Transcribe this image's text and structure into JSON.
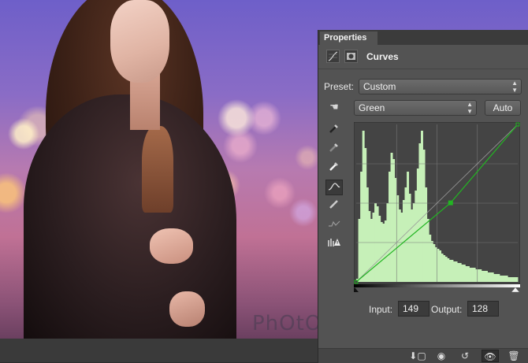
{
  "panel": {
    "tab_label": "Properties",
    "title": "Curves",
    "preset_label": "Preset:",
    "preset_value": "Custom",
    "channel_value": "Green",
    "auto_label": "Auto",
    "input_label": "Input:",
    "input_value": "149",
    "output_label": "Output:",
    "output_value": "128"
  },
  "icons": {
    "header": [
      "curves-adjustment-icon",
      "layer-mask-icon"
    ],
    "tools": [
      "on-image-adjust-icon",
      "set-black-point-eyedropper-icon",
      "set-gray-point-eyedropper-icon",
      "set-white-point-eyedropper-icon",
      "edit-points-curve-icon",
      "draw-pencil-icon",
      "smooth-curve-icon",
      "clipping-warning-icon"
    ],
    "footer": [
      "clip-to-layer-icon",
      "view-previous-state-icon",
      "reset-icon",
      "toggle-visibility-icon",
      "trash-icon"
    ]
  },
  "colors": {
    "curve": "#22b522",
    "histogram": "#c6f0b8",
    "panel_bg": "#535353"
  },
  "watermark": "PhOtOPrO",
  "curve": {
    "points": [
      [
        0,
        0
      ],
      [
        149,
        128
      ],
      [
        255,
        255
      ]
    ]
  },
  "histogram": [
    2,
    40,
    70,
    96,
    85,
    60,
    45,
    40,
    44,
    50,
    48,
    42,
    38,
    37,
    39,
    50,
    70,
    82,
    78,
    66,
    55,
    46,
    44,
    52,
    60,
    70,
    56,
    46,
    50,
    58,
    72,
    88,
    96,
    84,
    60,
    40,
    30,
    26,
    24,
    22,
    21,
    20,
    18,
    17,
    16,
    15,
    14,
    14,
    13,
    13,
    12,
    12,
    11,
    11,
    10,
    10,
    9,
    9,
    9,
    8,
    8,
    8,
    7,
    7,
    7,
    6,
    6,
    6,
    5,
    5,
    5,
    4,
    4,
    4,
    4,
    3,
    3,
    3,
    3,
    3
  ]
}
